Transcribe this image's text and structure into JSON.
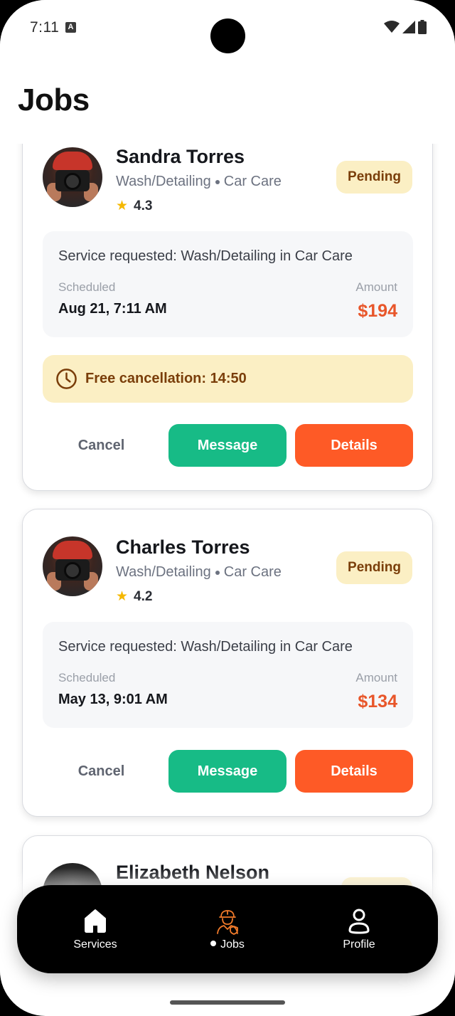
{
  "status_bar": {
    "time": "7:11",
    "notification_glyph": "A"
  },
  "header": {
    "title": "Jobs"
  },
  "jobs": [
    {
      "customer_name": "Sandra Torres",
      "service": "Wash/Detailing",
      "category": "Car Care",
      "rating": "4.3",
      "status": "Pending",
      "request_text": "Service requested: Wash/Detailing in Car Care",
      "scheduled_label": "Scheduled",
      "scheduled_value": "Aug 21, 7:11 AM",
      "amount_label": "Amount",
      "amount_value": "$194",
      "cancellation_text": "Free cancellation: 14:50",
      "cancel_label": "Cancel",
      "message_label": "Message",
      "details_label": "Details"
    },
    {
      "customer_name": "Charles Torres",
      "service": "Wash/Detailing",
      "category": "Car Care",
      "rating": "4.2",
      "status": "Pending",
      "request_text": "Service requested: Wash/Detailing in Car Care",
      "scheduled_label": "Scheduled",
      "scheduled_value": "May 13, 9:01 AM",
      "amount_label": "Amount",
      "amount_value": "$134",
      "cancel_label": "Cancel",
      "message_label": "Message",
      "details_label": "Details"
    },
    {
      "customer_name": "Elizabeth Nelson"
    }
  ],
  "bottom_nav": {
    "items": [
      {
        "label": "Services",
        "icon": "home-icon",
        "active": false
      },
      {
        "label": "Jobs",
        "icon": "worker-icon",
        "active": true
      },
      {
        "label": "Profile",
        "icon": "person-icon",
        "active": false
      }
    ],
    "active_color": "#f07a2a"
  },
  "colors": {
    "accent_green": "#17bb86",
    "accent_orange": "#fe5a26",
    "amount": "#e8562a",
    "pending_bg": "#fbefc4",
    "pending_text": "#7a3e0a"
  }
}
